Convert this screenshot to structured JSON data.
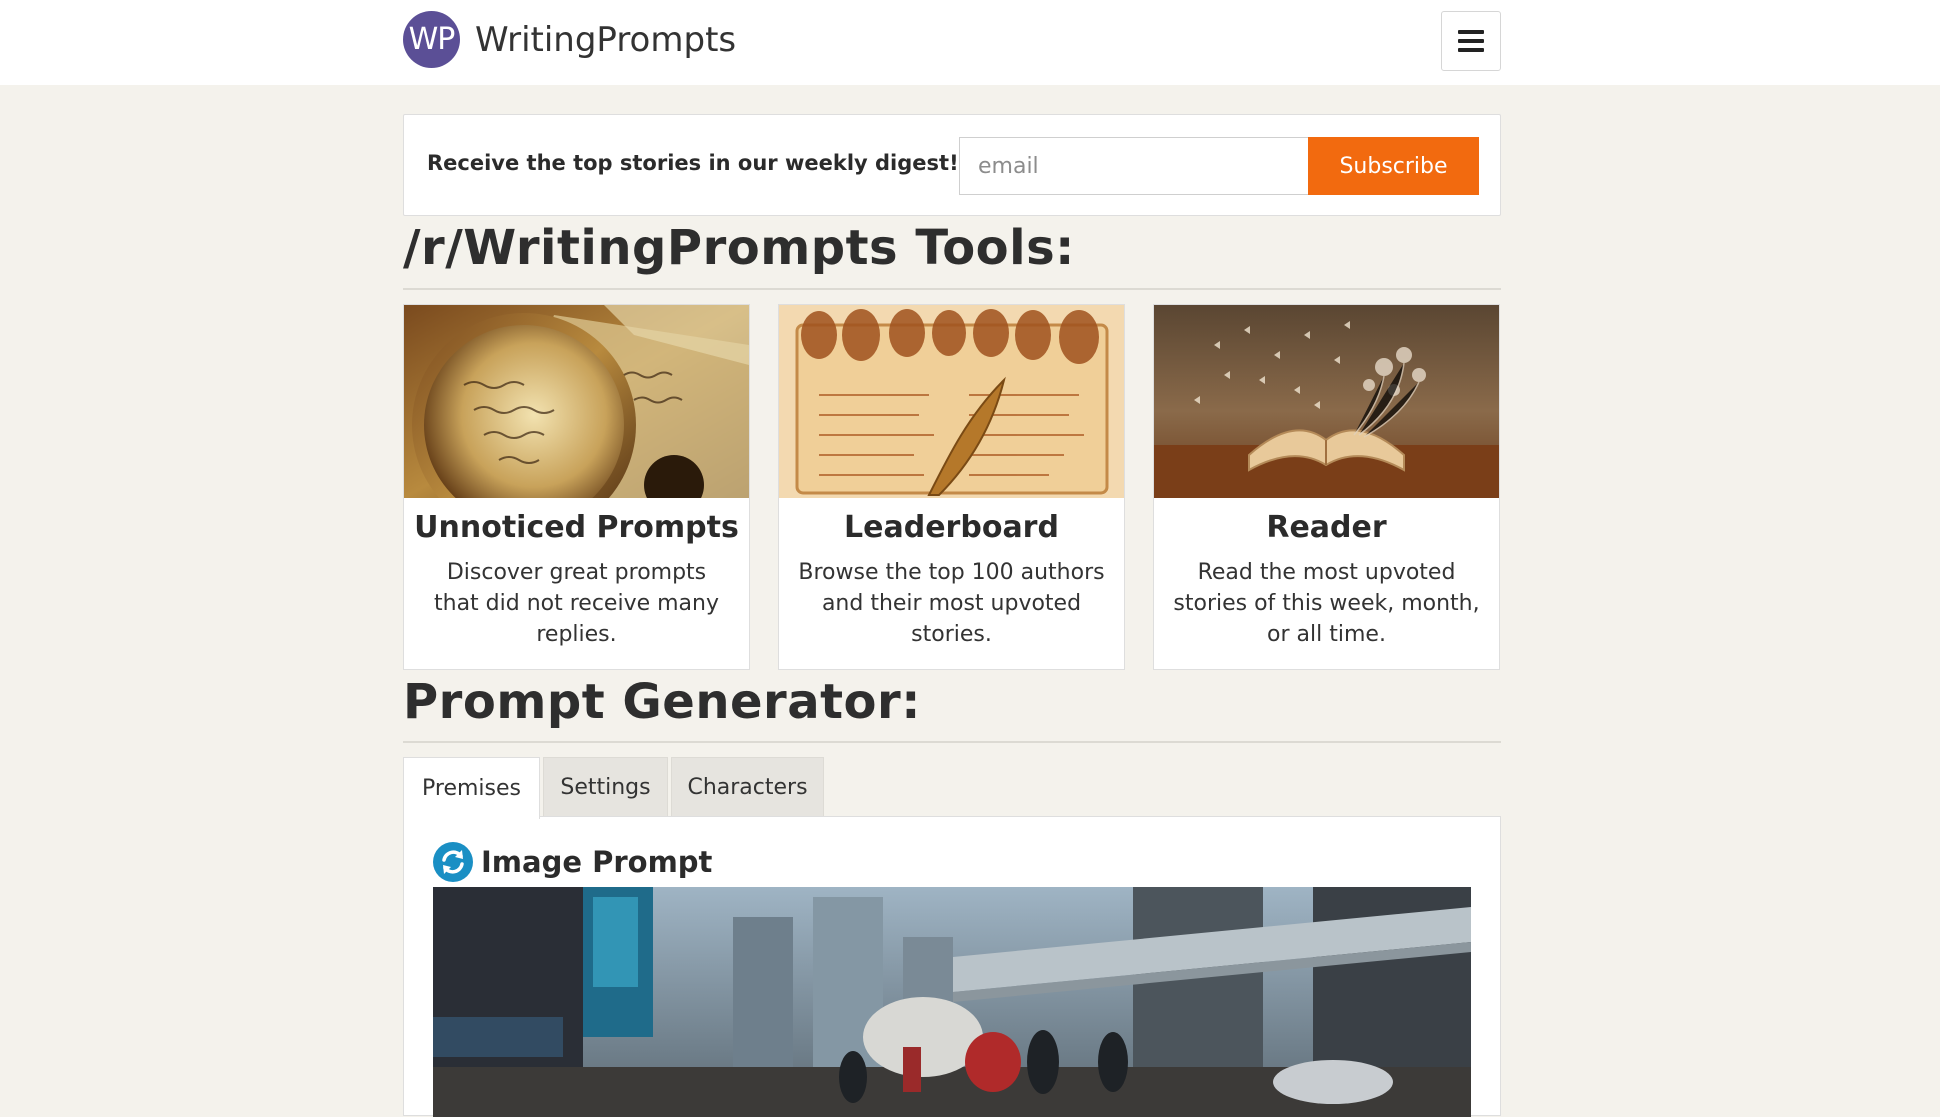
{
  "header": {
    "logo_text": "WP",
    "site_name": "WritingPrompts",
    "menu_icon": "hamburger-icon"
  },
  "digest": {
    "text": "Receive the top stories in our weekly digest!",
    "email_placeholder": "email",
    "email_value": "",
    "subscribe_label": "Subscribe"
  },
  "tools": {
    "title": "/r/WritingPrompts Tools:",
    "cards": [
      {
        "title": "Unnoticed Prompts",
        "description": "Discover great prompts that did not receive many replies."
      },
      {
        "title": "Leaderboard",
        "description": "Browse the top 100 authors and their most upvoted stories."
      },
      {
        "title": "Reader",
        "description": "Read the most upvoted stories of this week, month, or all time."
      }
    ]
  },
  "generator": {
    "title": "Prompt Generator:",
    "tabs": [
      {
        "label": "Premises",
        "active": true
      },
      {
        "label": "Settings",
        "active": false
      },
      {
        "label": "Characters",
        "active": false
      }
    ],
    "prompt_heading": "Image Prompt",
    "refresh_icon": "refresh-icon"
  },
  "colors": {
    "accent": "#f26a0f",
    "logo_bg": "#5b4f96",
    "page_bg": "#f4f2ec",
    "refresh": "#1a8fc4"
  }
}
